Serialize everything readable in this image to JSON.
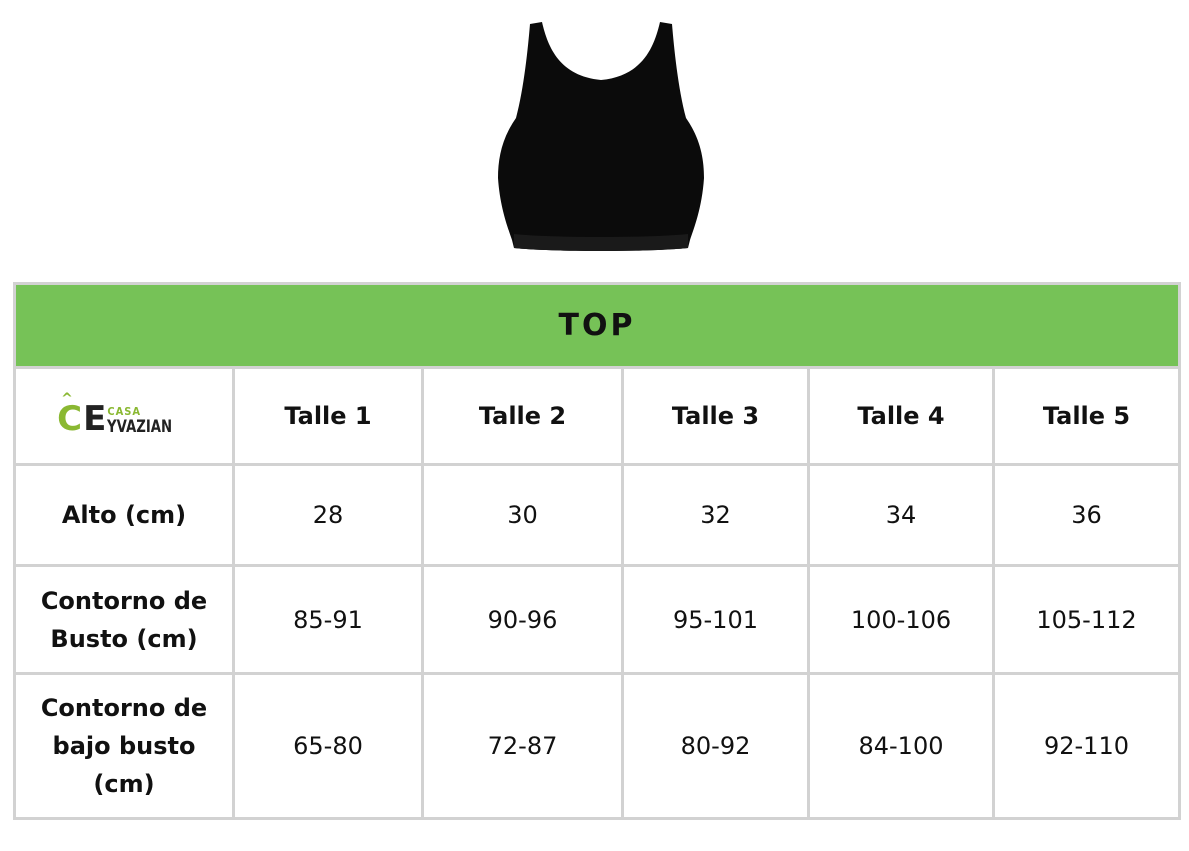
{
  "colors": {
    "title_bar": "#76c257",
    "grid": "#d2d2d2",
    "brand_green": "#8ab832",
    "brand_dark": "#222222"
  },
  "product_image_icon": "black-crop-top-image",
  "table": {
    "title": "TOP",
    "brand": {
      "c": "C",
      "casa": "CASA",
      "e": "E",
      "name": "YVAZIAN"
    },
    "sizes": [
      "Talle 1",
      "Talle 2",
      "Talle 3",
      "Talle 4",
      "Talle 5"
    ],
    "rows": [
      {
        "label": "Alto (cm)",
        "values": [
          "28",
          "30",
          "32",
          "34",
          "36"
        ]
      },
      {
        "label_lines": [
          "Contorno de",
          "Busto (cm)"
        ],
        "values": [
          "85-91",
          "90-96",
          "95-101",
          "100-106",
          "105-112"
        ]
      },
      {
        "label_lines": [
          "Contorno de",
          "bajo busto",
          "(cm)"
        ],
        "values": [
          "65-80",
          "72-87",
          "80-92",
          "84-100",
          "92-110"
        ]
      }
    ]
  }
}
